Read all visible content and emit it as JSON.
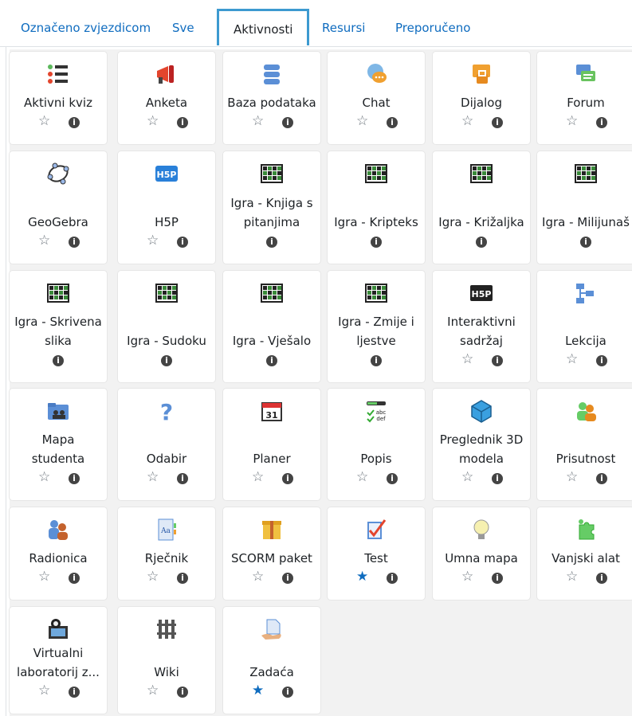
{
  "tabs": [
    {
      "label": "Označeno zvjezdicom"
    },
    {
      "label": "Sve"
    },
    {
      "label": "Aktivnosti"
    },
    {
      "label": "Resursi"
    },
    {
      "label": "Preporučeno"
    }
  ],
  "activities": [
    {
      "lines": [
        "Aktivni kviz"
      ],
      "icon": "list-icon",
      "star": "outline",
      "info": "i"
    },
    {
      "lines": [
        "Anketa"
      ],
      "icon": "megaphone-icon",
      "star": "outline",
      "info": "i"
    },
    {
      "lines": [
        "Baza podataka"
      ],
      "icon": "database-icon",
      "star": "outline",
      "info": "i"
    },
    {
      "lines": [
        "Chat"
      ],
      "icon": "chat-bubble-icon",
      "star": "outline",
      "info": "i"
    },
    {
      "lines": [
        "Dijalog"
      ],
      "icon": "dialogue-lock-icon",
      "star": "outline",
      "info": "i"
    },
    {
      "lines": [
        "Forum"
      ],
      "icon": "forum-icon",
      "star": "outline",
      "info": "i"
    },
    {
      "lines": [
        "GeoGebra"
      ],
      "icon": "geogebra-icon",
      "star": "outline",
      "info": "i"
    },
    {
      "lines": [
        "H5P"
      ],
      "icon": "h5p-icon",
      "star": "outline",
      "info": "i"
    },
    {
      "lines": [
        "Igra - Knjiga s",
        "pitanjima"
      ],
      "icon": "game-grid-icon",
      "star": "none",
      "info": "i"
    },
    {
      "lines": [
        "Igra - Kripteks"
      ],
      "icon": "game-grid-icon",
      "star": "none",
      "info": "i"
    },
    {
      "lines": [
        "Igra - Križaljka"
      ],
      "icon": "game-grid-icon",
      "star": "none",
      "info": "i"
    },
    {
      "lines": [
        "Igra - Milijunaš"
      ],
      "icon": "game-grid-icon",
      "star": "none",
      "info": "i"
    },
    {
      "lines": [
        "Igra - Skrivena",
        "slika"
      ],
      "icon": "game-grid-icon",
      "star": "none",
      "info": "i"
    },
    {
      "lines": [
        "Igra - Sudoku"
      ],
      "icon": "game-grid-icon",
      "star": "none",
      "info": "i"
    },
    {
      "lines": [
        "Igra - Vješalo"
      ],
      "icon": "game-grid-icon",
      "star": "none",
      "info": "i"
    },
    {
      "lines": [
        "Igra - Zmije i",
        "ljestve"
      ],
      "icon": "game-grid-icon",
      "star": "none",
      "info": "i"
    },
    {
      "lines": [
        "Interaktivni",
        "sadržaj"
      ],
      "icon": "h5p-dark-icon",
      "star": "outline",
      "info": "i"
    },
    {
      "lines": [
        "Lekcija"
      ],
      "icon": "lesson-tree-icon",
      "star": "outline",
      "info": "i"
    },
    {
      "lines": [
        "Mapa",
        "studenta"
      ],
      "icon": "folder-users-icon",
      "star": "outline",
      "info": "i"
    },
    {
      "lines": [
        "Odabir"
      ],
      "icon": "question-mark-icon",
      "star": "outline",
      "info": "i"
    },
    {
      "lines": [
        "Planer"
      ],
      "icon": "calendar-icon",
      "star": "outline",
      "info": "i"
    },
    {
      "lines": [
        "Popis"
      ],
      "icon": "checklist-icon",
      "star": "outline",
      "info": "i"
    },
    {
      "lines": [
        "Preglednik 3D",
        "modela"
      ],
      "icon": "cube-icon",
      "star": "outline",
      "info": "i"
    },
    {
      "lines": [
        "Prisutnost"
      ],
      "icon": "attendance-people-icon",
      "star": "outline",
      "info": "i"
    },
    {
      "lines": [
        "Radionica"
      ],
      "icon": "workshop-people-icon",
      "star": "outline",
      "info": "i"
    },
    {
      "lines": [
        "Rječnik"
      ],
      "icon": "glossary-book-icon",
      "star": "outline",
      "info": "i"
    },
    {
      "lines": [
        "SCORM paket"
      ],
      "icon": "scorm-package-icon",
      "star": "outline",
      "info": "i"
    },
    {
      "lines": [
        "Test"
      ],
      "icon": "test-check-icon",
      "star": "filled",
      "info": "i"
    },
    {
      "lines": [
        "Umna mapa"
      ],
      "icon": "lightbulb-icon",
      "star": "outline",
      "info": "i"
    },
    {
      "lines": [
        "Vanjski alat"
      ],
      "icon": "puzzle-icon",
      "star": "outline",
      "info": "i"
    },
    {
      "lines": [
        "Virtualni",
        "laboratorij z..."
      ],
      "icon": "virtual-lab-icon",
      "star": "outline",
      "info": "i"
    },
    {
      "lines": [
        "Wiki"
      ],
      "icon": "wiki-icon",
      "star": "outline",
      "info": "i"
    },
    {
      "lines": [
        "Zadaća"
      ],
      "icon": "assignment-hand-icon",
      "star": "filled",
      "info": "i"
    }
  ],
  "colors": {
    "link": "#0f6cbf",
    "active_tab_border": "#3d9ad0",
    "grid_bg": "#f2f2f2",
    "star_filled": "#0f6cbf"
  }
}
